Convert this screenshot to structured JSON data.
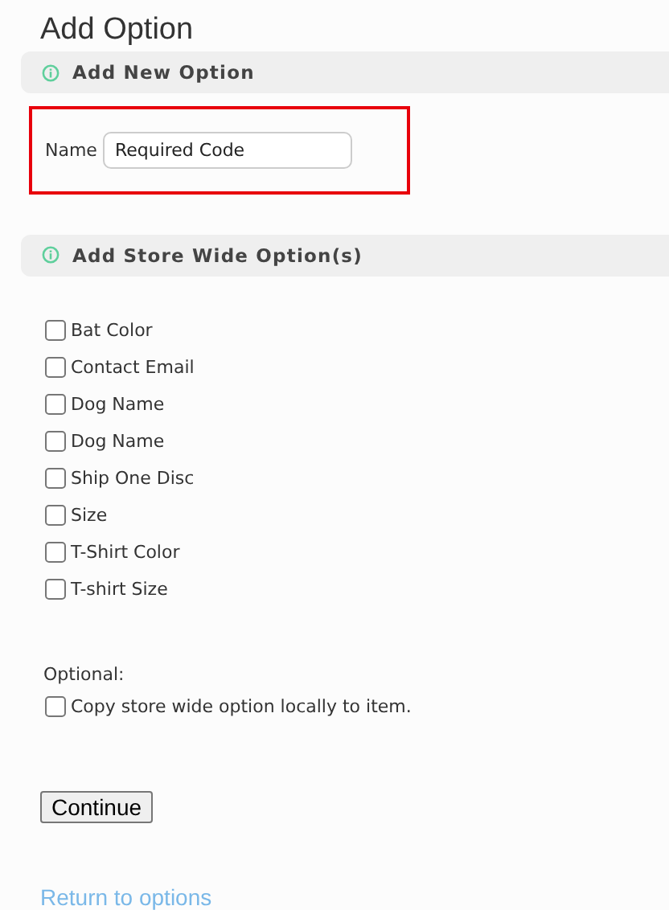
{
  "title": "Add Option",
  "sections": [
    {
      "heading": "Add New Option"
    },
    {
      "heading": "Add Store Wide Option(s)"
    }
  ],
  "name_field": {
    "label": "Name",
    "value": "Required Code",
    "highlighted": true
  },
  "options": [
    {
      "label": "Bat Color",
      "checked": false
    },
    {
      "label": "Contact Email",
      "checked": false
    },
    {
      "label": "Dog Name",
      "checked": false
    },
    {
      "label": "Dog Name",
      "checked": false
    },
    {
      "label": "Ship One Disc",
      "checked": false
    },
    {
      "label": "Size",
      "checked": false
    },
    {
      "label": "T-Shirt Color",
      "checked": false
    },
    {
      "label": "T-shirt Size",
      "checked": false
    }
  ],
  "optional_label": "Optional:",
  "copy_option": {
    "label": "Copy store wide option locally to item.",
    "checked": false
  },
  "continue_button": "Continue",
  "return_link": "Return to options"
}
